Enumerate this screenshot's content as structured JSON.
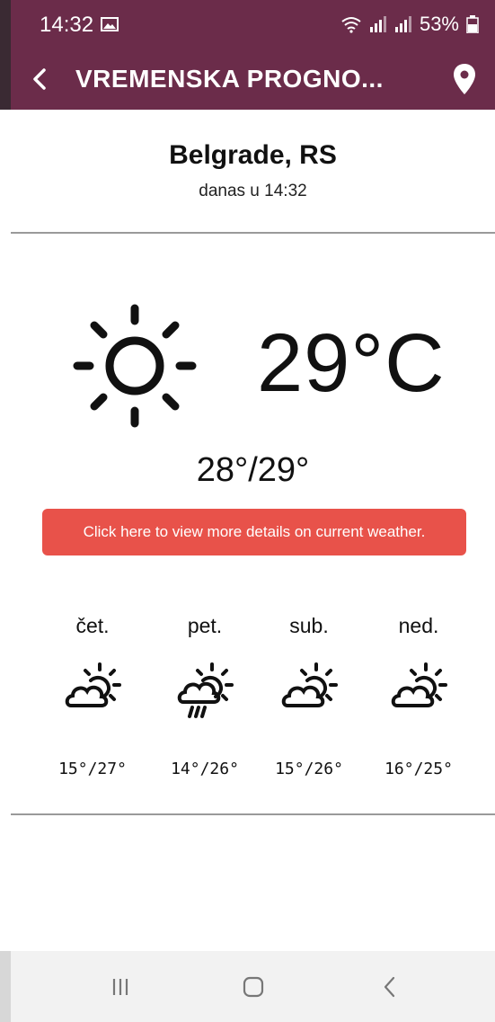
{
  "status_bar": {
    "time": "14:32",
    "battery": "53%",
    "icons": [
      "image-icon",
      "wifi-icon",
      "signal-icon",
      "signal-icon",
      "battery-icon"
    ]
  },
  "app_bar": {
    "title": "VREMENSKA PROGNO...",
    "back_icon": "back-arrow-icon",
    "location_icon": "location-pin-icon",
    "color": "#6b2c4a"
  },
  "location": {
    "city": "Belgrade, RS",
    "updated": "danas u 14:32"
  },
  "current": {
    "icon": "sun-icon",
    "temperature": "29°C",
    "min_max": "28°/29°"
  },
  "details_button": {
    "label": "Click here to view more details on current weather.",
    "color": "#e8524a"
  },
  "forecast": [
    {
      "day": "čet.",
      "icon": "partly-cloudy-icon",
      "range": "15°/27°"
    },
    {
      "day": "pet.",
      "icon": "partly-cloudy-rain-icon",
      "range": "14°/26°"
    },
    {
      "day": "sub.",
      "icon": "partly-cloudy-icon",
      "range": "15°/26°"
    },
    {
      "day": "ned.",
      "icon": "partly-cloudy-icon",
      "range": "16°/25°"
    }
  ],
  "nav_bar": {
    "buttons": [
      "recent-apps-icon",
      "home-icon",
      "back-icon"
    ]
  }
}
